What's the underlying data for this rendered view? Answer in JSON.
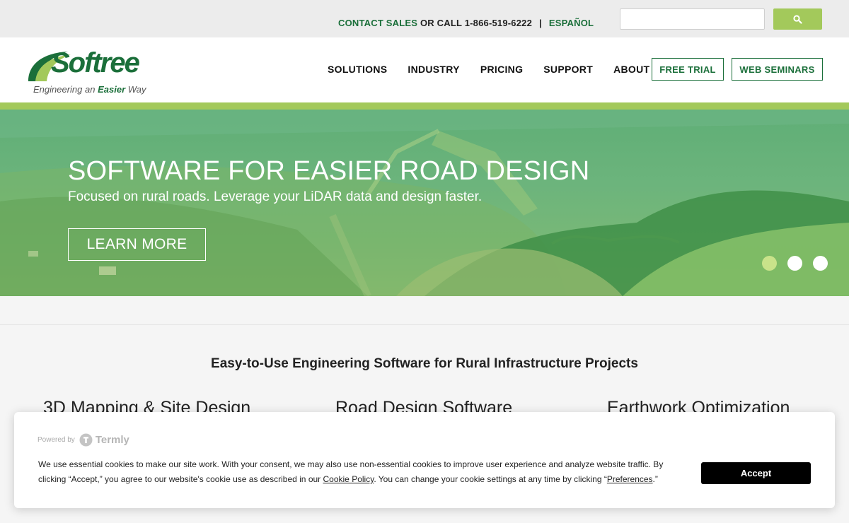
{
  "topbar": {
    "contact_label": "CONTACT SALES",
    "call_label": "OR CALL 1-866-519-6222",
    "separator": "|",
    "language_label": "ESPAÑOL",
    "search_value": "",
    "search_icon": "search-icon"
  },
  "logo": {
    "word": "Softree",
    "tagline_prefix": "Engineering an",
    "tagline_emphasis": "Easier",
    "tagline_suffix": "Way"
  },
  "nav": {
    "items": [
      {
        "label": "SOLUTIONS"
      },
      {
        "label": "INDUSTRY"
      },
      {
        "label": "PRICING"
      },
      {
        "label": "SUPPORT"
      },
      {
        "label": "ABOUT"
      }
    ],
    "free_trial_label": "FREE TRIAL",
    "web_seminars_label": "WEB SEMINARS"
  },
  "hero": {
    "title": "SOFTWARE FOR EASIER ROAD DESIGN",
    "subtitle": "Focused on rural roads. Leverage your LiDAR data and design faster.",
    "button_label": "LEARN MORE",
    "slides_total": 3,
    "active_slide": 1
  },
  "main": {
    "section_title": "Easy-to-Use Engineering Software for Rural Infrastructure Projects",
    "columns": [
      {
        "title": "3D Mapping & Site Design"
      },
      {
        "title": "Road Design Software"
      },
      {
        "title": "Earthwork Optimization"
      }
    ]
  },
  "cookie_banner": {
    "powered_by": "Powered by",
    "brand": "Termly",
    "text_part1": "We use essential cookies to make our site work. With your consent, we may also use non-essential cookies to improve user experience and analyze website traffic. By clicking “Accept,” you agree to our website's cookie use as described in our ",
    "cookie_policy_link": "Cookie Policy",
    "text_part2": ". You can change your cookie settings at any time by clicking “",
    "preferences_link": "Preferences",
    "text_part3": ".”",
    "accept_label": "Accept"
  },
  "colors": {
    "brand_green": "#1b6f3a",
    "accent_lime": "#a3c95b",
    "hero_overlay": "#5fae76",
    "active_dot": "#c9e38a"
  }
}
